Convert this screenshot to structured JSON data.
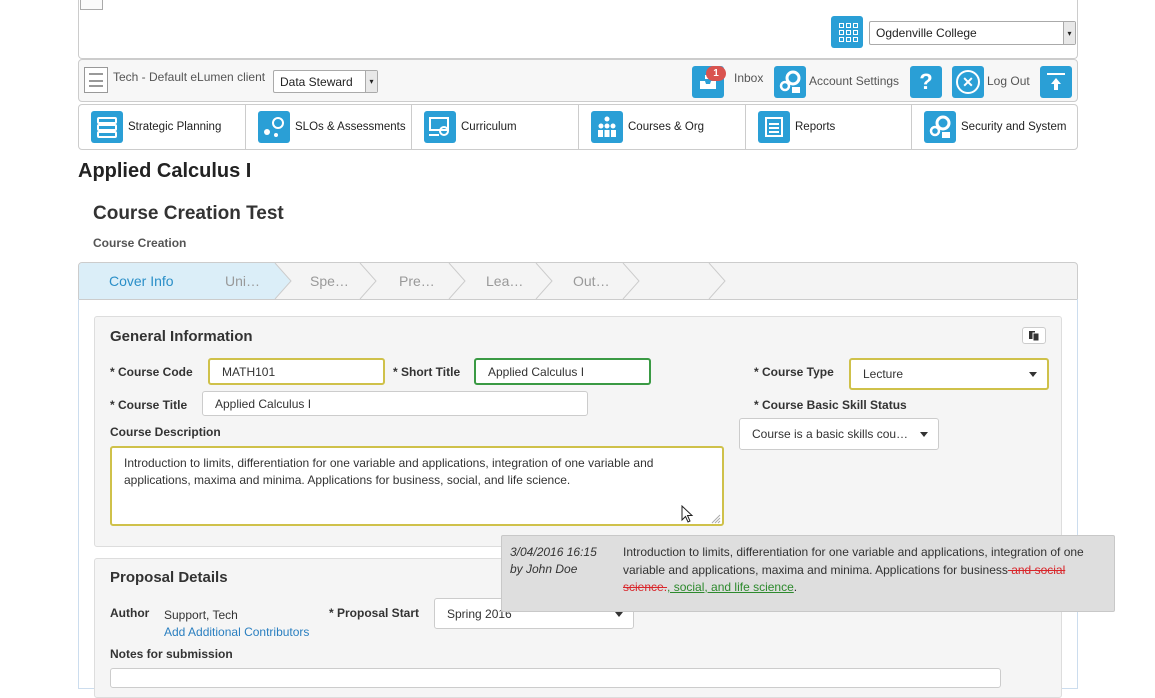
{
  "header": {
    "institution_select": "Ogdenville College",
    "client_name": "Tech - Default eLumen client",
    "role_select": "Data Steward",
    "inbox_badge": "1",
    "inbox_label": "Inbox",
    "account_settings_label": "Account Settings",
    "logout_label": "Log Out"
  },
  "nav": {
    "items": [
      {
        "label": "Strategic Planning",
        "icon": "strategic-planning-icon"
      },
      {
        "label": "SLOs & Assessments",
        "icon": "slo-icon"
      },
      {
        "label": "Curriculum",
        "icon": "curriculum-icon"
      },
      {
        "label": "Courses & Org",
        "icon": "people-icon"
      },
      {
        "label": "Reports",
        "icon": "reports-icon"
      },
      {
        "label": "Security and System",
        "icon": "gears-lock-icon"
      }
    ]
  },
  "page": {
    "title": "Applied Calculus I",
    "subtitle": "Course Creation Test",
    "section": "Course Creation"
  },
  "steps": [
    "Cover Info",
    "Uni…",
    "Spe…",
    "Pre…",
    "Lea…",
    "Out…"
  ],
  "general": {
    "heading": "General Information",
    "course_code_label": "* Course Code",
    "course_code": "MATH101",
    "short_title_label": "* Short Title",
    "short_title": "Applied Calculus I",
    "course_type_label": "* Course Type",
    "course_type": "Lecture",
    "course_title_label": "* Course Title",
    "course_title": "Applied Calculus I",
    "basic_skill_label": "* Course Basic Skill Status",
    "basic_skill": "Course is a basic skills cou…",
    "description_label": "Course Description",
    "description": "Introduction to limits, differentiation for one variable and applications, integration of one variable and applications, maxima and minima. Applications for business, social, and life science."
  },
  "tooltip": {
    "date": "3/04/2016 16:15",
    "author": "by John Doe",
    "text_before": "Introduction to limits, differentiation for one variable and applications, integration of one variable and applications, maxima and minima. Applications for business",
    "deleted": " and social science.",
    "inserted": ", social, and life science",
    "text_after": "."
  },
  "proposal": {
    "heading": "Proposal Details",
    "author_label": "Author",
    "author_value": "Support, Tech",
    "add_contributors": "Add Additional Contributors",
    "proposal_start_label": "* Proposal Start",
    "proposal_start": "Spring 2016",
    "notes_label": "Notes for submission"
  },
  "colors": {
    "accent": "#2a9fd6",
    "active_step_bg": "#dbeef8",
    "required_border": "#cfc14a",
    "valid_border": "#3a9a44",
    "badge": "#d9534f"
  }
}
